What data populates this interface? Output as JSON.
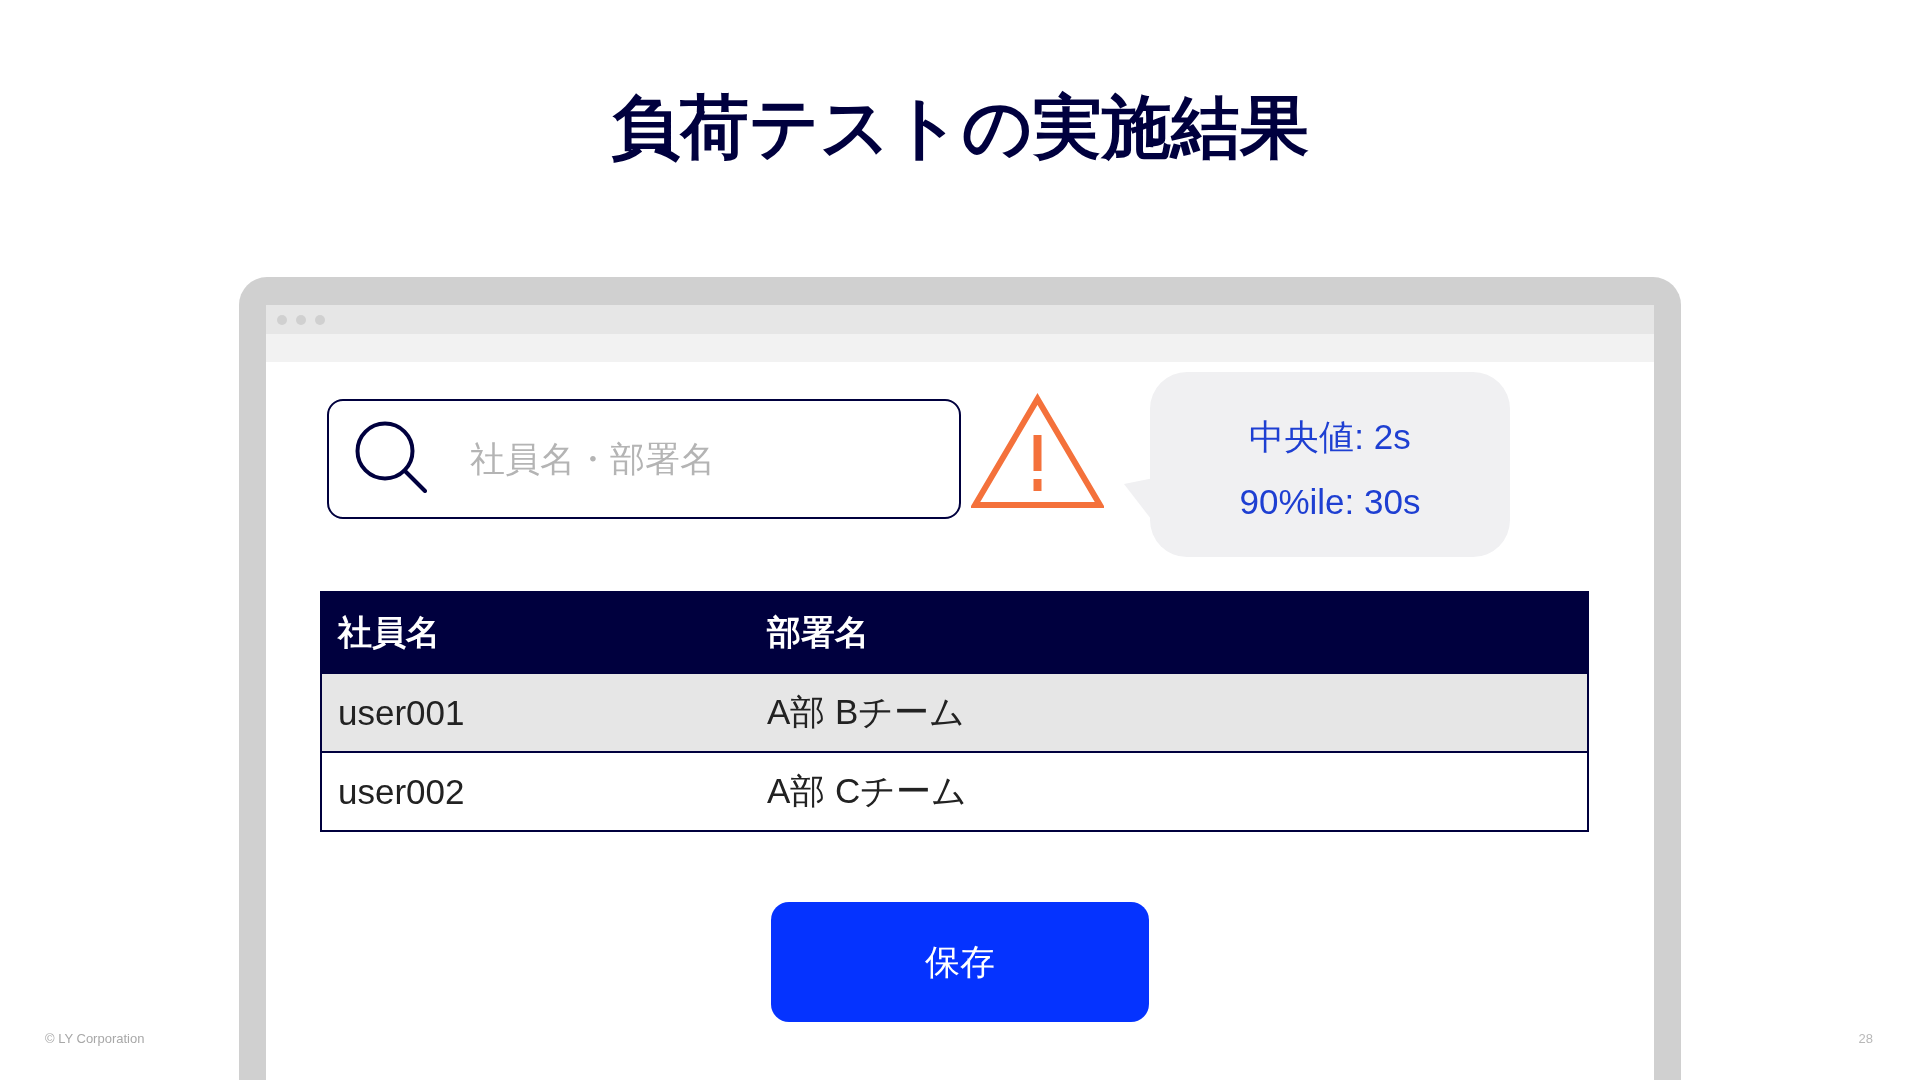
{
  "slide": {
    "title": "負荷テストの実施結果"
  },
  "browser_mockup": {
    "search_field": {
      "placeholder": "社員名・部署名"
    },
    "stats_bubble": {
      "lines": [
        "中央値: 2s",
        "90%ile: 30s"
      ]
    },
    "table": {
      "columns": [
        "社員名",
        "部署名"
      ],
      "rows": [
        {
          "cells": [
            "user001",
            "A部 Bチーム"
          ]
        },
        {
          "cells": [
            "user002",
            "A部 Cチーム"
          ]
        }
      ]
    },
    "save_button": {
      "label": "保存"
    }
  },
  "footer": {
    "copyright": "© LY Corporation",
    "page_number": "28"
  }
}
